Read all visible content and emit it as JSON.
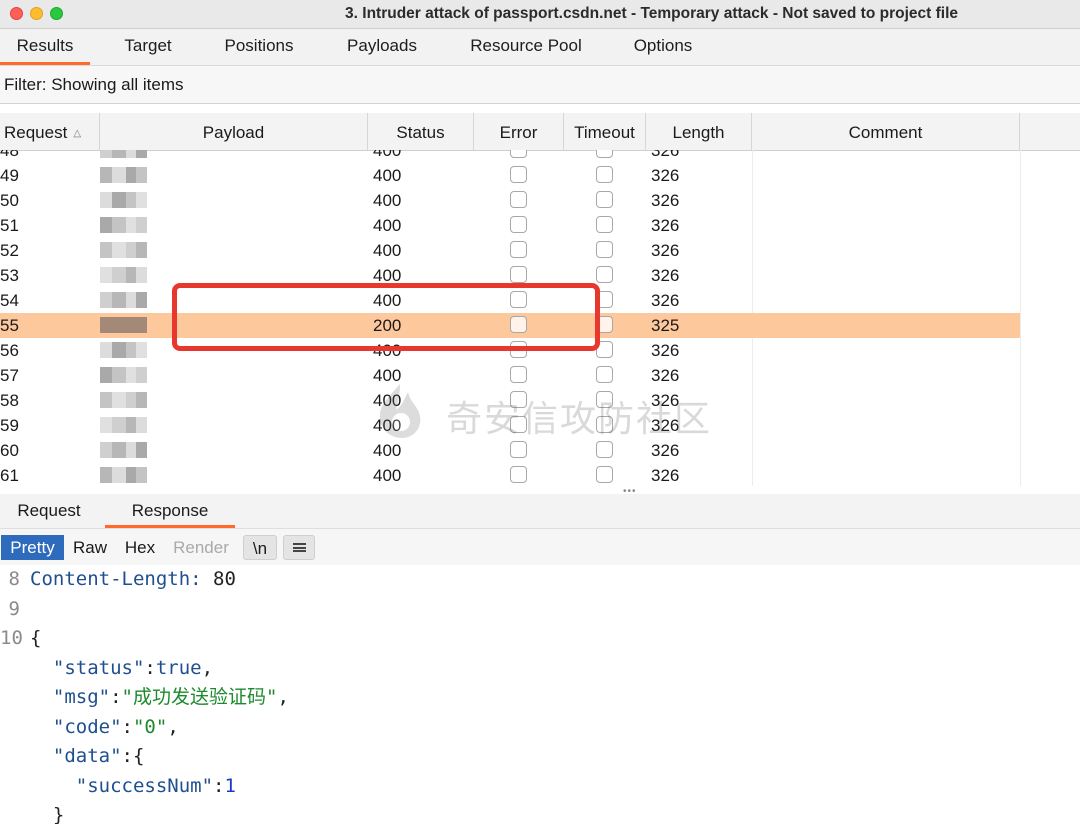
{
  "window": {
    "title": "3. Intruder attack of passport.csdn.net - Temporary attack - Not saved to project file"
  },
  "tabs": [
    {
      "label": "Results",
      "active": true
    },
    {
      "label": "Target"
    },
    {
      "label": "Positions"
    },
    {
      "label": "Payloads"
    },
    {
      "label": "Resource Pool"
    },
    {
      "label": "Options"
    }
  ],
  "filter": {
    "label": "Filter: Showing all items"
  },
  "table": {
    "columns": [
      "Request",
      "Payload",
      "Status",
      "Error",
      "Timeout",
      "Length",
      "Comment"
    ],
    "sort_column": "Request",
    "sort_direction": "ascending",
    "rows": [
      {
        "request": "48",
        "status": "400",
        "length": "326",
        "error": false,
        "timeout": false,
        "selected": false
      },
      {
        "request": "49",
        "status": "400",
        "length": "326",
        "error": false,
        "timeout": false,
        "selected": false
      },
      {
        "request": "50",
        "status": "400",
        "length": "326",
        "error": false,
        "timeout": false,
        "selected": false
      },
      {
        "request": "51",
        "status": "400",
        "length": "326",
        "error": false,
        "timeout": false,
        "selected": false
      },
      {
        "request": "52",
        "status": "400",
        "length": "326",
        "error": false,
        "timeout": false,
        "selected": false
      },
      {
        "request": "53",
        "status": "400",
        "length": "326",
        "error": false,
        "timeout": false,
        "selected": false
      },
      {
        "request": "54",
        "status": "400",
        "length": "326",
        "error": false,
        "timeout": false,
        "selected": false
      },
      {
        "request": "55",
        "status": "200",
        "length": "325",
        "error": false,
        "timeout": false,
        "selected": true
      },
      {
        "request": "56",
        "status": "400",
        "length": "326",
        "error": false,
        "timeout": false,
        "selected": false
      },
      {
        "request": "57",
        "status": "400",
        "length": "326",
        "error": false,
        "timeout": false,
        "selected": false
      },
      {
        "request": "58",
        "status": "400",
        "length": "326",
        "error": false,
        "timeout": false,
        "selected": false
      },
      {
        "request": "59",
        "status": "400",
        "length": "326",
        "error": false,
        "timeout": false,
        "selected": false
      },
      {
        "request": "60",
        "status": "400",
        "length": "326",
        "error": false,
        "timeout": false,
        "selected": false
      },
      {
        "request": "61",
        "status": "400",
        "length": "326",
        "error": false,
        "timeout": false,
        "selected": false
      }
    ]
  },
  "watermark": {
    "text": "奇安信攻防社区"
  },
  "lower_tabs": [
    {
      "label": "Request"
    },
    {
      "label": "Response",
      "active": true
    }
  ],
  "view_modes": {
    "pretty": "Pretty",
    "raw": "Raw",
    "hex": "Hex",
    "render": "Render",
    "newline": "\\n",
    "menu_icon": "hamburger-menu-icon"
  },
  "response_lines": [
    {
      "num": "8",
      "text": "Content-Length: 80"
    },
    {
      "num": "9",
      "text": ""
    },
    {
      "num": "10",
      "text": "{"
    },
    {
      "num": "",
      "text": "  \"status\":true,"
    },
    {
      "num": "",
      "text": "  \"msg\":\"成功发送验证码\","
    },
    {
      "num": "",
      "text": "  \"code\":\"0\","
    },
    {
      "num": "",
      "text": "  \"data\":{"
    },
    {
      "num": "",
      "text": "    \"successNum\":1"
    },
    {
      "num": "",
      "text": "  }"
    }
  ],
  "colors": {
    "selected_row": "#fdc89c",
    "highlight_box": "#e8372c",
    "active_tab_underline": "#ff6a2b",
    "pretty_button": "#2f6bbd"
  }
}
